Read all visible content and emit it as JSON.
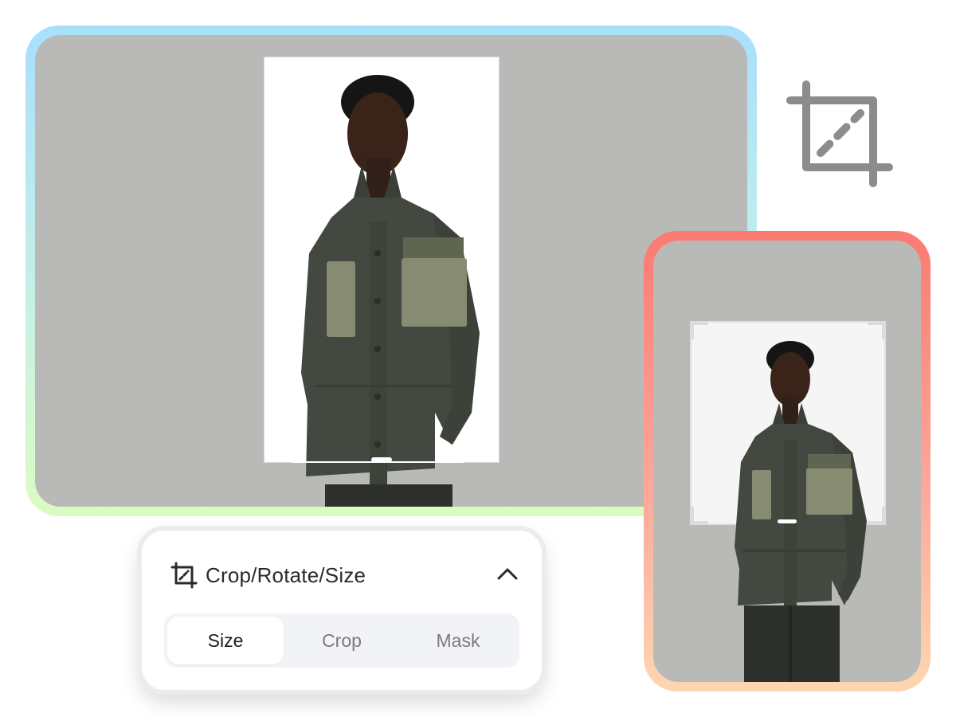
{
  "panel": {
    "title": "Crop/Rotate/Size",
    "tabs": [
      {
        "label": "Size",
        "active": true
      },
      {
        "label": "Crop",
        "active": false
      },
      {
        "label": "Mask",
        "active": false
      }
    ]
  },
  "icons": {
    "crop": "crop-icon",
    "chevron": "chevron-up-icon"
  },
  "colors": {
    "canvas": "#b9bab8",
    "jacket": "#434840",
    "pocket": "#878b72",
    "main_card_gradient": [
      "#a8e0fb",
      "#dcfbc2"
    ],
    "side_card_gradient": [
      "#fb7a72",
      "#fdd7b1"
    ]
  }
}
